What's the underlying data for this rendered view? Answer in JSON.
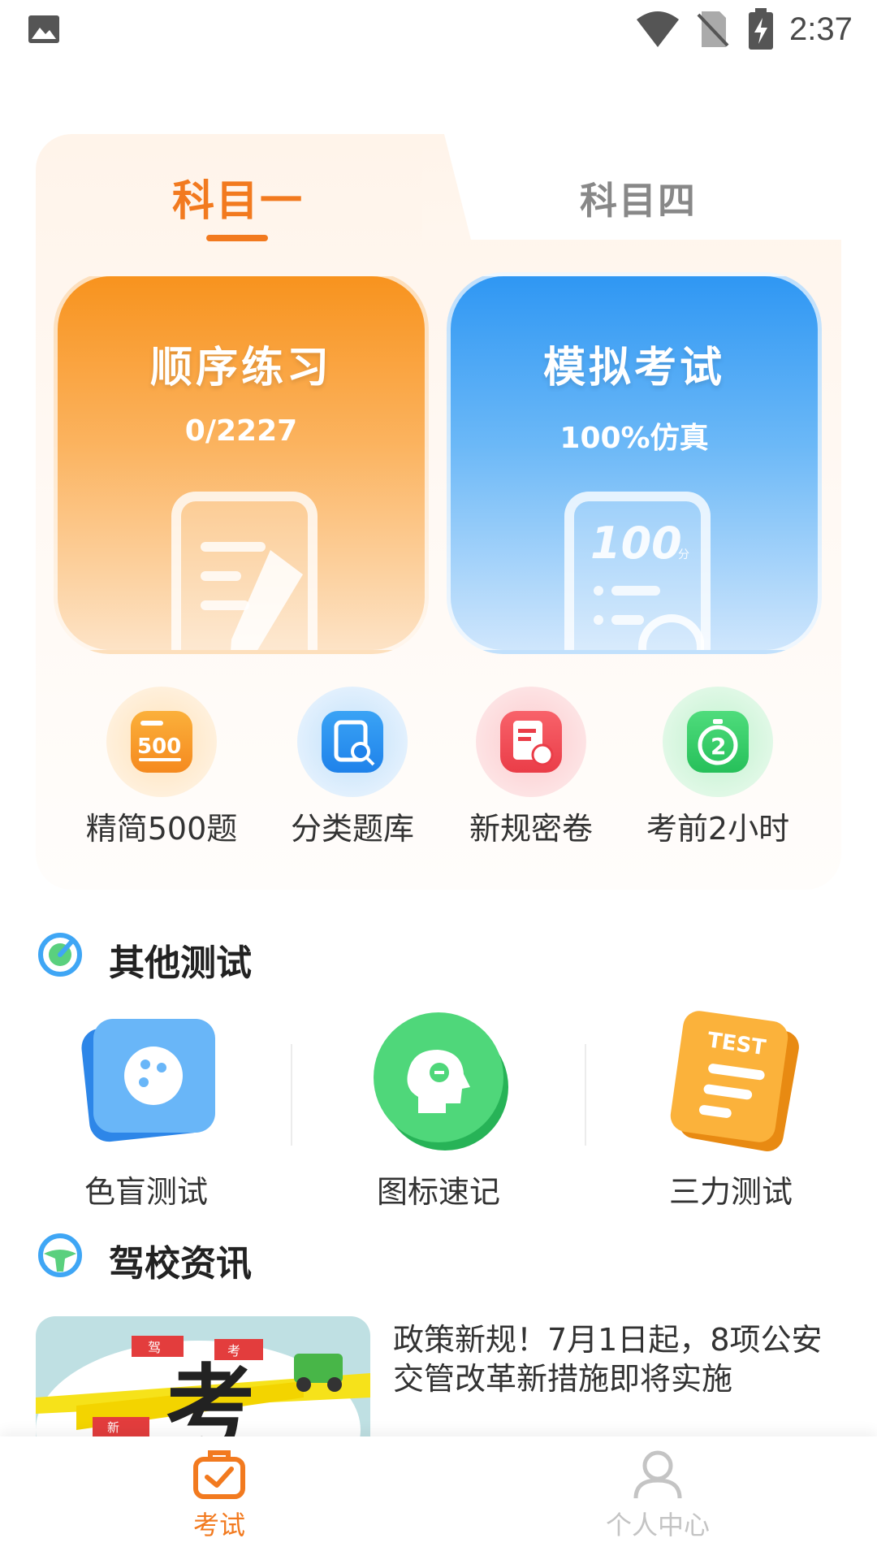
{
  "status_bar": {
    "time": "2:37"
  },
  "subject_tabs": [
    {
      "label": "科目一",
      "active": true
    },
    {
      "label": "科目四",
      "active": false
    }
  ],
  "practice": {
    "sequential": {
      "title": "顺序练习",
      "progress": "0/2227"
    },
    "mock_exam": {
      "title": "模拟考试",
      "subtitle": "100%仿真",
      "doc_score": "100",
      "doc_unit": "分"
    }
  },
  "quick_actions": [
    {
      "label": "精简500题",
      "icon": "500-icon",
      "badge": "500"
    },
    {
      "label": "分类题库",
      "icon": "category-search-icon"
    },
    {
      "label": "新规密卷",
      "icon": "new-rules-paper-icon"
    },
    {
      "label": "考前2小时",
      "icon": "stopwatch-icon",
      "badge": "2"
    }
  ],
  "other_tests": {
    "title": "其他测试",
    "items": [
      {
        "label": "色盲测试",
        "icon": "palette-icon"
      },
      {
        "label": "图标速记",
        "icon": "head-memory-icon"
      },
      {
        "label": "三力测试",
        "icon": "test-list-icon",
        "badge": "TEST"
      }
    ]
  },
  "news": {
    "title": "驾校资讯",
    "items": [
      {
        "title": "政策新规！7月1日起，8项公安交管改革新措施即将实施",
        "thumb_signs": [
          "驾",
          "考",
          "新"
        ],
        "thumb_char": "考"
      }
    ]
  },
  "bottom_nav": [
    {
      "label": "考试",
      "icon": "exam-icon",
      "active": true
    },
    {
      "label": "个人中心",
      "icon": "person-icon",
      "active": false
    }
  ],
  "colors": {
    "accent": "#f27a1f",
    "blue": "#2f97f3",
    "green": "#3ccf6a"
  }
}
